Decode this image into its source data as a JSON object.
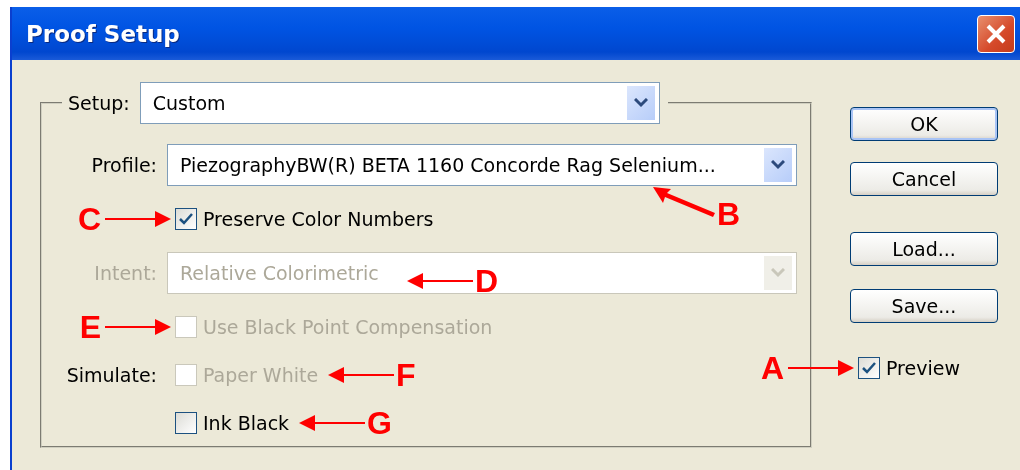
{
  "window": {
    "title": "Proof Setup"
  },
  "setup": {
    "label": "Setup:",
    "value": "Custom"
  },
  "profile": {
    "label": "Profile:",
    "value": "PiezographyBW(R) BETA 1160 Concorde Rag Selenium...",
    "callout": {
      "letter": "B",
      "kind": "below"
    }
  },
  "preserve": {
    "label": "Preserve Color Numbers",
    "checked": true,
    "disabled": false,
    "callout": {
      "letter": "C",
      "kind": "before"
    }
  },
  "intent": {
    "label": "Intent:",
    "value": "Relative Colorimetric",
    "disabled": true,
    "callout": {
      "letter": "D",
      "kind": "after"
    }
  },
  "black_point": {
    "label": "Use Black Point Compensation",
    "checked": false,
    "disabled": true,
    "callout": {
      "letter": "E",
      "kind": "before"
    }
  },
  "simulate": {
    "label": "Simulate:",
    "options": [
      {
        "label": "Paper White",
        "checked": false,
        "disabled": true,
        "callout": {
          "letter": "F",
          "kind": "after"
        }
      },
      {
        "label": "Ink Black",
        "checked": false,
        "disabled": false,
        "callout": {
          "letter": "G",
          "kind": "after"
        }
      }
    ]
  },
  "buttons": [
    {
      "label": "OK",
      "default": true
    },
    {
      "label": "Cancel",
      "default": false
    },
    {
      "label": "Load...",
      "default": false
    },
    {
      "label": "Save...",
      "default": false
    }
  ],
  "preview": {
    "label": "Preview",
    "checked": true,
    "callout": {
      "letter": "A",
      "kind": "before"
    }
  }
}
